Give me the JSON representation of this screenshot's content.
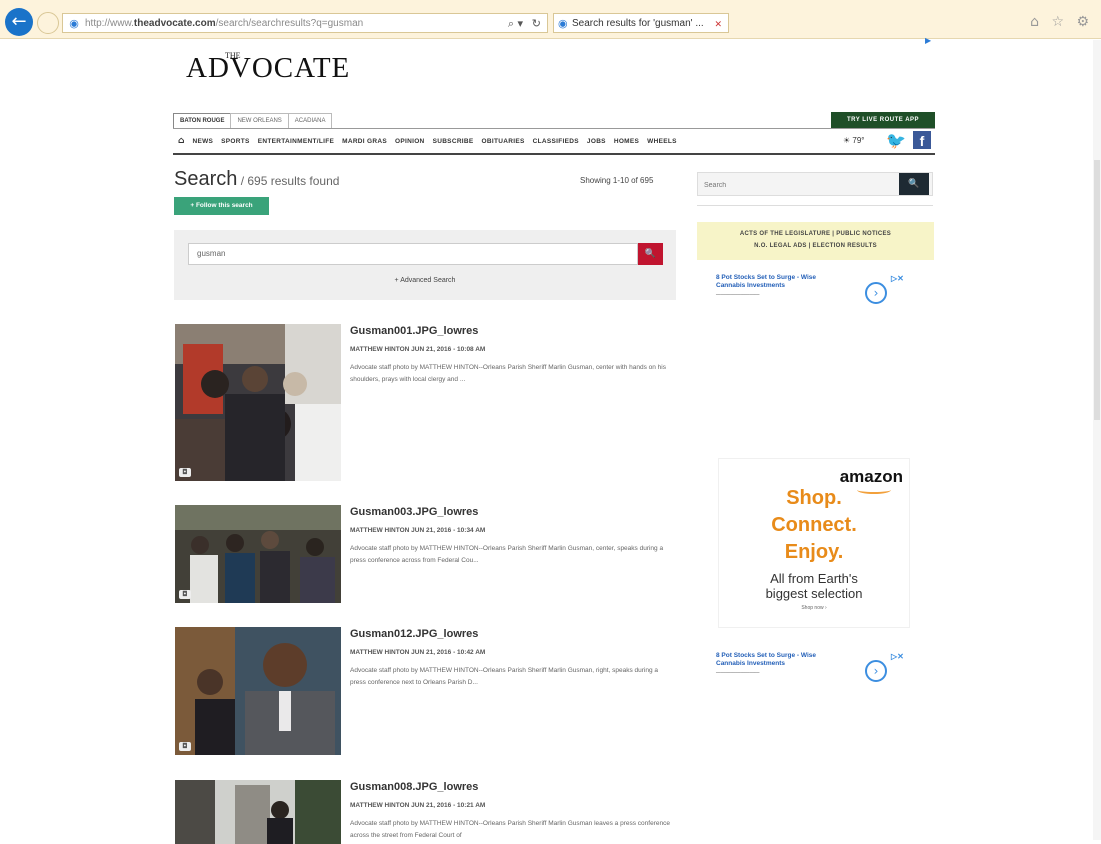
{
  "browser": {
    "url_prefix": "http://www.",
    "url_domain": "theadvocate.com",
    "url_path": "/search/searchresults?q=gusman",
    "tab_title": "Search results for 'gusman' ...",
    "back_icon": "arrow-left",
    "icons": "⌂ ☆ ⚙"
  },
  "site": {
    "logo_small": "THE",
    "logo": "ADVOCATE",
    "editions": [
      "BATON ROUGE",
      "NEW ORLEANS",
      "ACADIANA"
    ],
    "cta": "TRY LIVE ROUTE APP",
    "nav": [
      "NEWS",
      "SPORTS",
      "ENTERTAINMENT/LIFE",
      "MARDI GRAS",
      "OPINION",
      "SUBSCRIBE",
      "OBITUARIES",
      "CLASSIFIEDS",
      "JOBS",
      "HOMES",
      "WHEELS"
    ],
    "weather": "☀ 79°",
    "twitter": "🐦",
    "facebook": "f"
  },
  "search": {
    "title": "Search",
    "count": " / 695 results found",
    "showing": "Showing 1-10 of 695",
    "follow": "+ Follow this search",
    "query": "gusman",
    "advanced": "+ Advanced Search"
  },
  "sidebar": {
    "search_placeholder": "Search",
    "legal_row1": "ACTS OF THE LEGISLATURE  |  PUBLIC NOTICES",
    "legal_row2": "N.O. LEGAL ADS  |  ELECTION RESULTS",
    "ad1_headline": "8 Pot Stocks Set to Surge - Wise Cannabis Investments",
    "ad2_headline": "8 Pot Stocks Set to Surge - Wise Cannabis Investments",
    "amazon_brand": "amazon",
    "amazon_line1": "Shop.",
    "amazon_line2": "Connect.",
    "amazon_line3": "Enjoy.",
    "amazon_tag1": "All from Earth's",
    "amazon_tag2": "biggest selection",
    "amazon_shop": "Shop now ›"
  },
  "results": [
    {
      "title": "Gusman001.JPG_lowres",
      "author": "MATTHEW HINTON",
      "date": "JUN 21, 2016 - 10:08 AM",
      "caption": "Advocate staff photo by MATTHEW HINTON--Orleans Parish Sheriff Marlin Gusman, center with hands on his shoulders, prays with local clergy and ..."
    },
    {
      "title": "Gusman003.JPG_lowres",
      "author": "MATTHEW HINTON",
      "date": "JUN 21, 2016 - 10:34 AM",
      "caption": "Advocate staff photo by MATTHEW HINTON--Orleans Parish Sheriff Marlin Gusman, center, speaks during a press conference across from Federal Cou..."
    },
    {
      "title": "Gusman012.JPG_lowres",
      "author": "MATTHEW HINTON",
      "date": "JUN 21, 2016 - 10:42 AM",
      "caption": "Advocate staff photo by MATTHEW HINTON--Orleans Parish Sheriff Marlin Gusman, right, speaks during a press conference next to Orleans Parish D..."
    },
    {
      "title": "Gusman008.JPG_lowres",
      "author": "MATTHEW HINTON",
      "date": "JUN 21, 2016 - 10:21 AM",
      "caption": "Advocate staff photo by MATTHEW HINTON--Orleans Parish Sheriff Marlin Gusman leaves a press conference across the street from Federal Court of"
    }
  ]
}
